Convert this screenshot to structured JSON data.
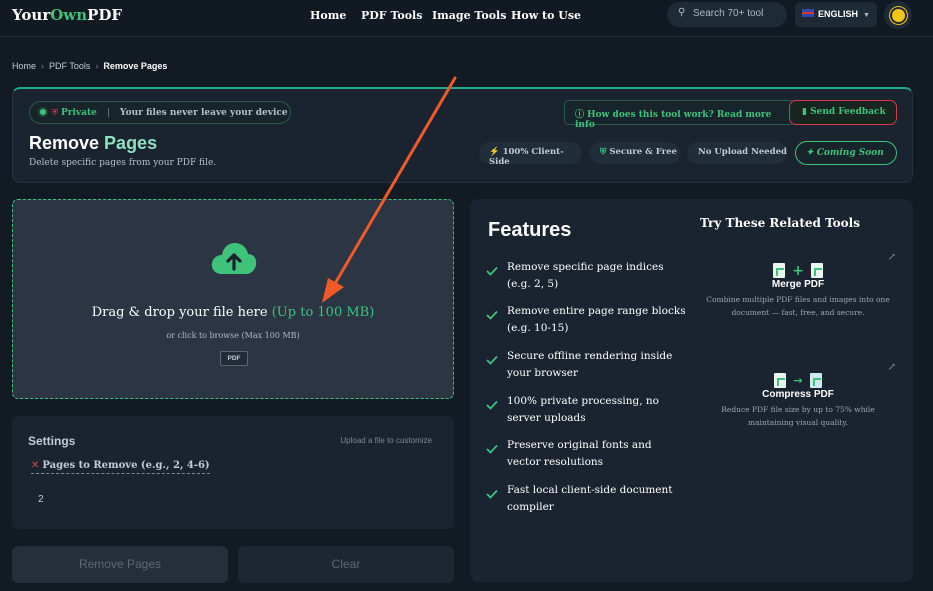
{
  "brand": {
    "logo_part1": "Your",
    "logo_part2": "Own",
    "logo_part3": "PDF"
  },
  "nav": {
    "items": [
      "Home",
      "PDF Tools",
      "Image Tools",
      "How to Use"
    ]
  },
  "search": {
    "placeholder": "Search 70+ tool"
  },
  "language": {
    "label": "ENGLISH"
  },
  "breadcrumb": {
    "items": [
      "Home",
      "PDF Tools",
      "Remove Pages"
    ]
  },
  "header": {
    "private_label": "Private",
    "private_desc": "Your files never leave your device",
    "title_part1": "Remove",
    "title_part2": "Pages",
    "subtitle": "Delete specific pages from your PDF file.",
    "how_link": "How does this tool work? Read more info",
    "feedback_button": "Send Feedback",
    "badges": [
      "100% Client-Side",
      "Secure & Free",
      "No Upload Needed"
    ],
    "coming_soon": "Coming Soon"
  },
  "dropzone": {
    "title": "Drag & drop your file here",
    "limit": "(Up to 100 MB)",
    "hint": "or click to browse (Max 100 MB)",
    "format": "PDF"
  },
  "settings": {
    "title": "Settings",
    "hint": "Upload a file to customize",
    "field_label": "Pages to Remove (e.g., 2, 4-6)",
    "field_value": "2"
  },
  "actions": {
    "remove": "Remove Pages",
    "clear": "Clear"
  },
  "features": {
    "title": "Features",
    "items": [
      "Remove specific page indices (e.g. 2, 5)",
      "Remove entire page range blocks (e.g. 10-15)",
      "Secure offline rendering inside your browser",
      "100% private processing, no server uploads",
      "Preserve original fonts and vector resolutions",
      "Fast local client-side document compiler"
    ]
  },
  "related": {
    "title": "Try These Related Tools",
    "tools": [
      {
        "name": "Merge PDF",
        "desc": "Combine multiple PDF files and images into one document — fast, free, and secure."
      },
      {
        "name": "Compress PDF",
        "desc": "Reduce PDF file size by up to 75% while maintaining visual quality."
      }
    ]
  },
  "colors": {
    "accent": "#3fc27a",
    "background": "#121a24",
    "card": "#1a2430",
    "annotation_arrow": "#f05a28"
  }
}
